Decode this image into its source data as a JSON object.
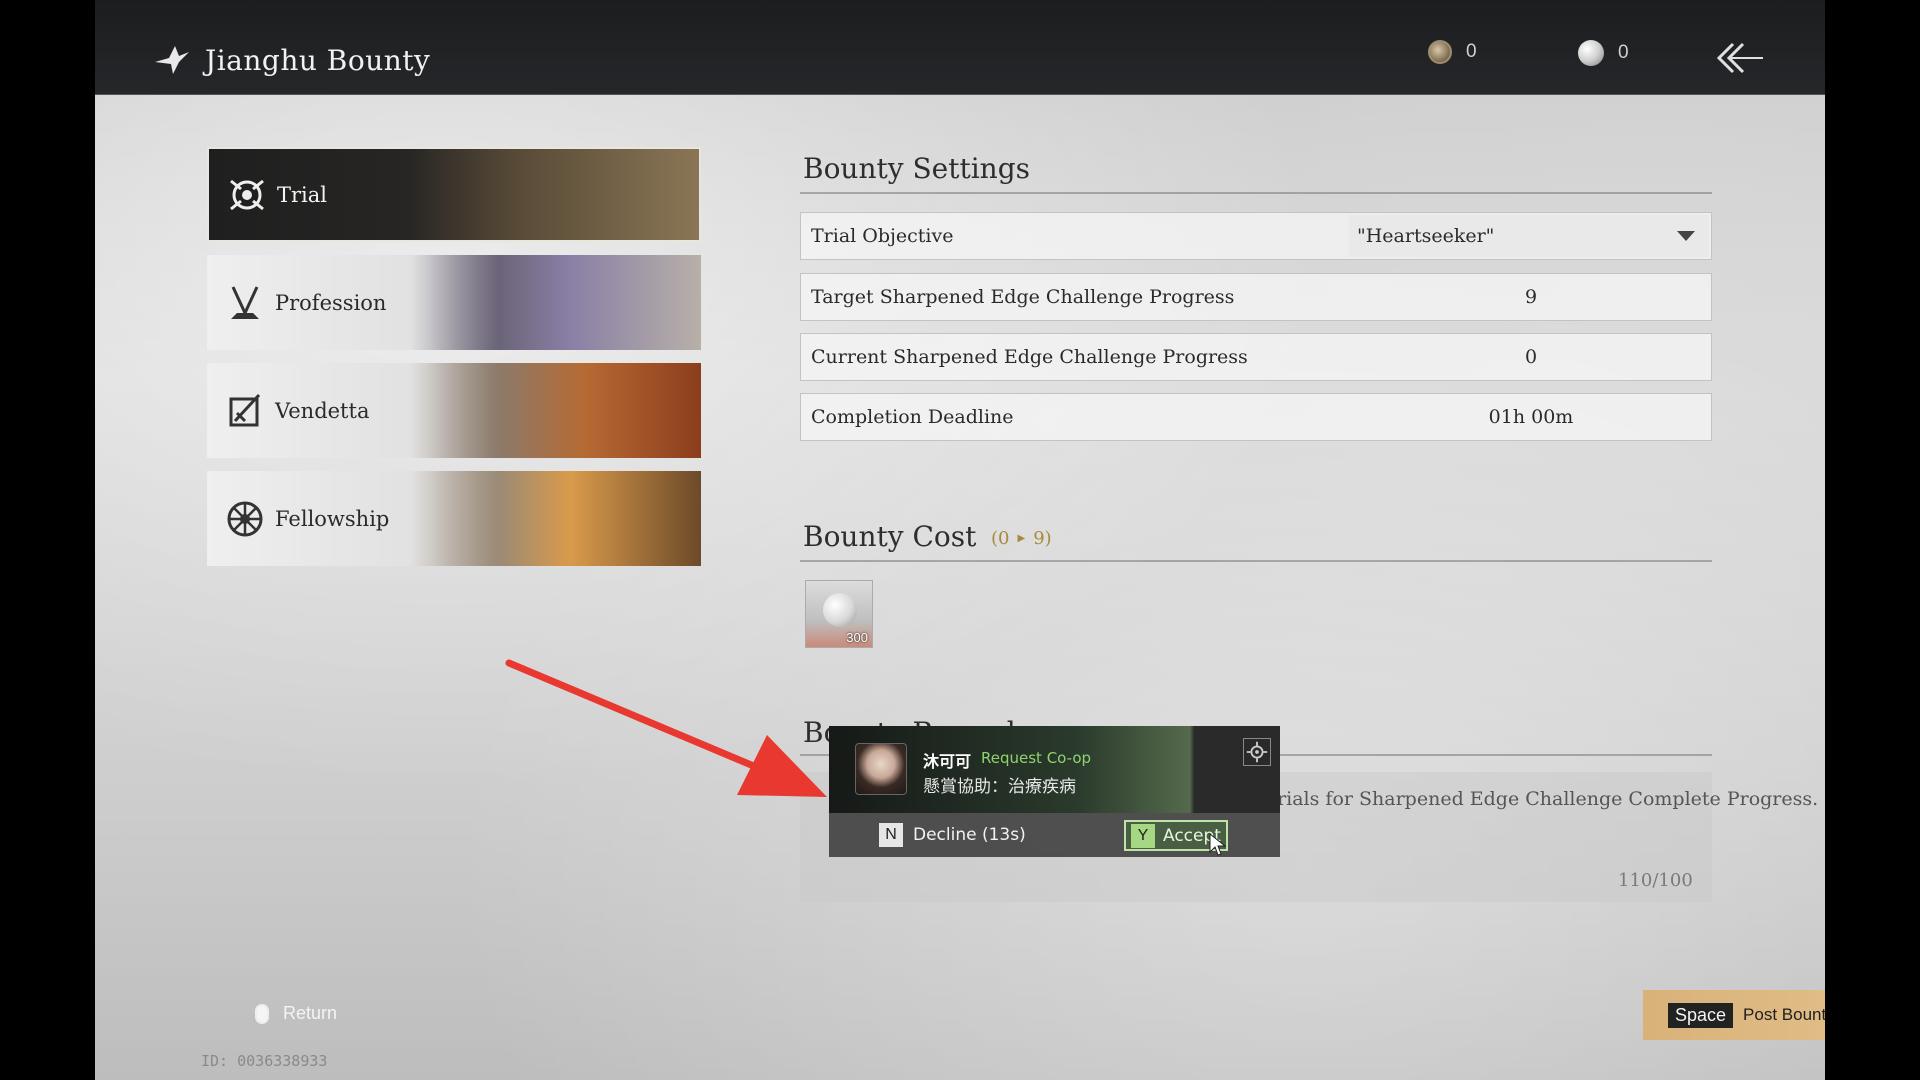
{
  "header": {
    "title": "Jianghu Bounty",
    "coin_count": "0",
    "pearl_count": "0",
    "icons": {
      "title": "bird-icon",
      "coin": "coin-icon",
      "pearl": "pearl-icon",
      "back": "back-arrow-icon"
    }
  },
  "menu": {
    "items": [
      {
        "label": "Trial",
        "icon": "trial-icon",
        "selected": true
      },
      {
        "label": "Profession",
        "icon": "profession-icon",
        "selected": false
      },
      {
        "label": "Vendetta",
        "icon": "vendetta-icon",
        "selected": false
      },
      {
        "label": "Fellowship",
        "icon": "fellowship-icon",
        "selected": false
      }
    ]
  },
  "settings": {
    "title": "Bounty Settings",
    "rows": [
      {
        "label": "Trial Objective",
        "value": "\"Heartseeker\""
      },
      {
        "label": "Target Sharpened Edge Challenge Progress",
        "value": "9"
      },
      {
        "label": "Current Sharpened Edge Challenge Progress",
        "value": "0"
      },
      {
        "label": "Completion Deadline",
        "value": "01h 00m"
      }
    ]
  },
  "cost": {
    "title": "Bounty Cost",
    "range_from": "(0",
    "range_to": "9)",
    "item_qty": "300"
  },
  "remark": {
    "title": "Bounty Remark",
    "text": "e the trials for Sharpened Edge Challenge Complete Progress.",
    "count": "110/100"
  },
  "popup": {
    "name": "沐可可",
    "request": "Request Co-op",
    "subtitle": "懸賞協助：治療疾病",
    "decline_key": "N",
    "decline_label": "Decline (13s)",
    "accept_key": "Y",
    "accept_label": "Accept"
  },
  "footer": {
    "return_label": "Return",
    "id_text": "ID: 0036338933",
    "post_key": "Space",
    "post_label": "Post Bounty"
  },
  "colors": {
    "accent_gold": "#d9b27a",
    "accept_green": "#8fd36f",
    "arrow_red": "#e8382f"
  }
}
